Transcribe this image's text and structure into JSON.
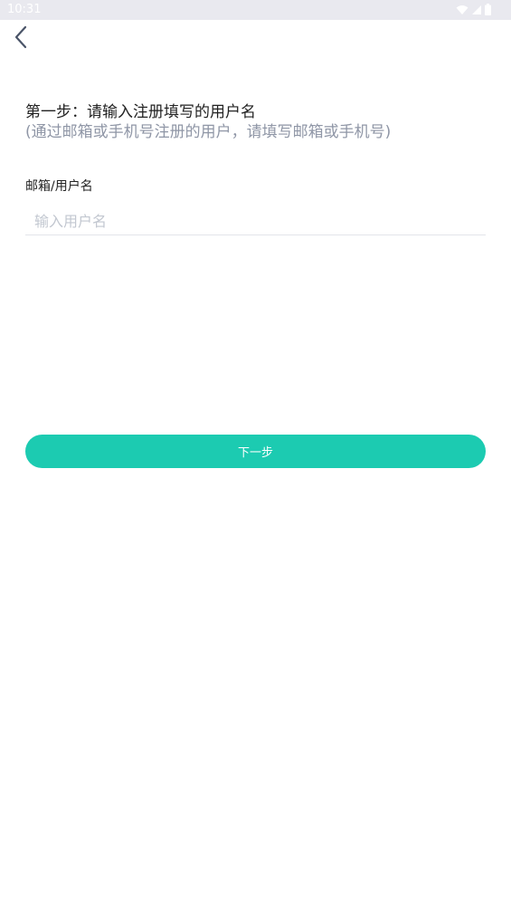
{
  "status_bar": {
    "time": "10:31",
    "icons": [
      "wifi-icon",
      "signal-icon",
      "battery-icon"
    ]
  },
  "nav": {
    "back_icon": "chevron-left-icon"
  },
  "form": {
    "step_title": "第一步：请输入注册填写的用户名",
    "step_hint": "(通过邮箱或手机号注册的用户，请填写邮箱或手机号)",
    "field_label": "邮箱/用户名",
    "username_value": "",
    "username_placeholder": "输入用户名",
    "next_label": "下一步"
  },
  "colors": {
    "accent": "#1ccbb1",
    "hint_text": "#8f96a6",
    "status_bar_bg": "#e9e9ef"
  }
}
